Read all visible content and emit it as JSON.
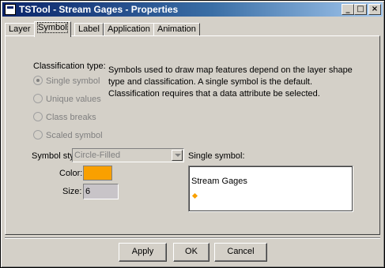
{
  "window": {
    "title": "TSTool - Stream Gages - Properties"
  },
  "titlebar_buttons": {
    "minimize": "_",
    "maximize": "□",
    "close": "×"
  },
  "tabs": [
    {
      "label": "Layer"
    },
    {
      "label": "Symbol"
    },
    {
      "label": "Label"
    },
    {
      "label": "Application"
    },
    {
      "label": "Animation"
    }
  ],
  "classification": {
    "label": "Classification type:",
    "options": [
      {
        "label": "Single symbol",
        "checked": true,
        "enabled": false
      },
      {
        "label": "Unique values",
        "checked": false,
        "enabled": false
      },
      {
        "label": "Class breaks",
        "checked": false,
        "enabled": false
      },
      {
        "label": "Scaled symbol",
        "checked": false,
        "enabled": false
      }
    ],
    "description_lines": [
      "Symbols used to draw map features depend on the layer shape",
      "type and classification.  A single symbol is the default.",
      "Classification requires that a data attribute be selected."
    ]
  },
  "symbol_style": {
    "label": "Symbol style:",
    "value": "Circle-Filled"
  },
  "color": {
    "label": "Color:",
    "value": "#f9a000"
  },
  "size": {
    "label": "Size:",
    "value": "6"
  },
  "single_symbol": {
    "label": "Single symbol:",
    "layer_name": "Stream Gages"
  },
  "buttons": {
    "apply": "Apply",
    "ok": "OK",
    "cancel": "Cancel"
  }
}
